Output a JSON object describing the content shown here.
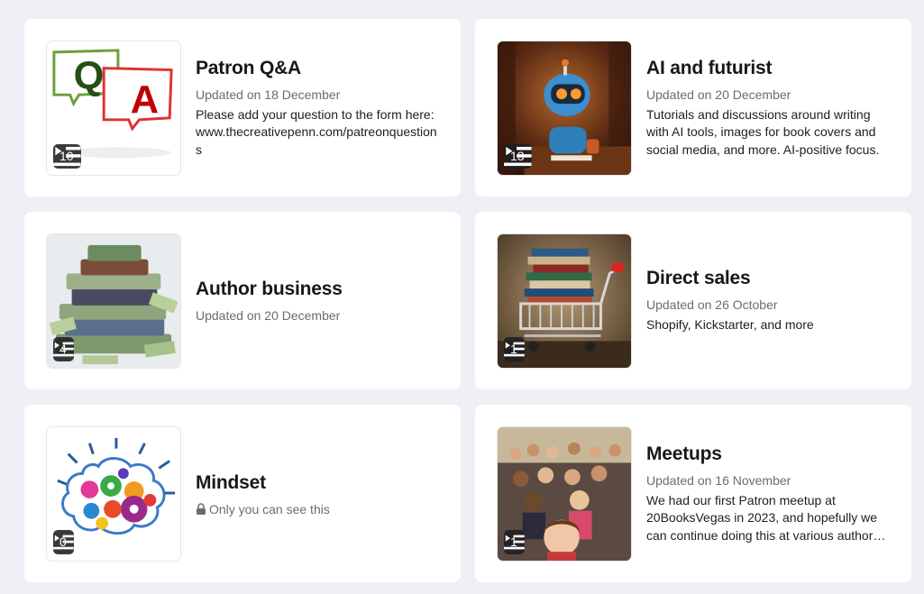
{
  "collections": [
    {
      "title": "Patron Q&A",
      "updated": "Updated on 18 December",
      "description": "Please add your question to the form here: www.thecreativepenn.com/patreonquestions",
      "count": "10",
      "image": "qa-speech-bubbles"
    },
    {
      "title": "AI and futurist",
      "updated": "Updated on 20 December",
      "description": "Tutorials and discussions around writing with AI tools, images for book covers and social media, and more. AI-positive focus.",
      "count": "13",
      "image": "robot-writing"
    },
    {
      "title": "Author business",
      "updated": "Updated on 20 December",
      "count": "4",
      "image": "books-and-money-pile"
    },
    {
      "title": "Direct sales",
      "updated": "Updated on 26 October",
      "description": "Shopify, Kickstarter, and more",
      "count": "1",
      "image": "shopping-cart-books"
    },
    {
      "title": "Mindset",
      "private_label": "Only you can see this",
      "count": "0",
      "image": "brain-gears"
    },
    {
      "title": "Meetups",
      "updated": "Updated on 16 November",
      "description": "We had our first Patron meetup at 20BooksVegas in 2023, and hopefully we can continue doing this at various author events.",
      "count": "1",
      "image": "group-selfie"
    }
  ]
}
